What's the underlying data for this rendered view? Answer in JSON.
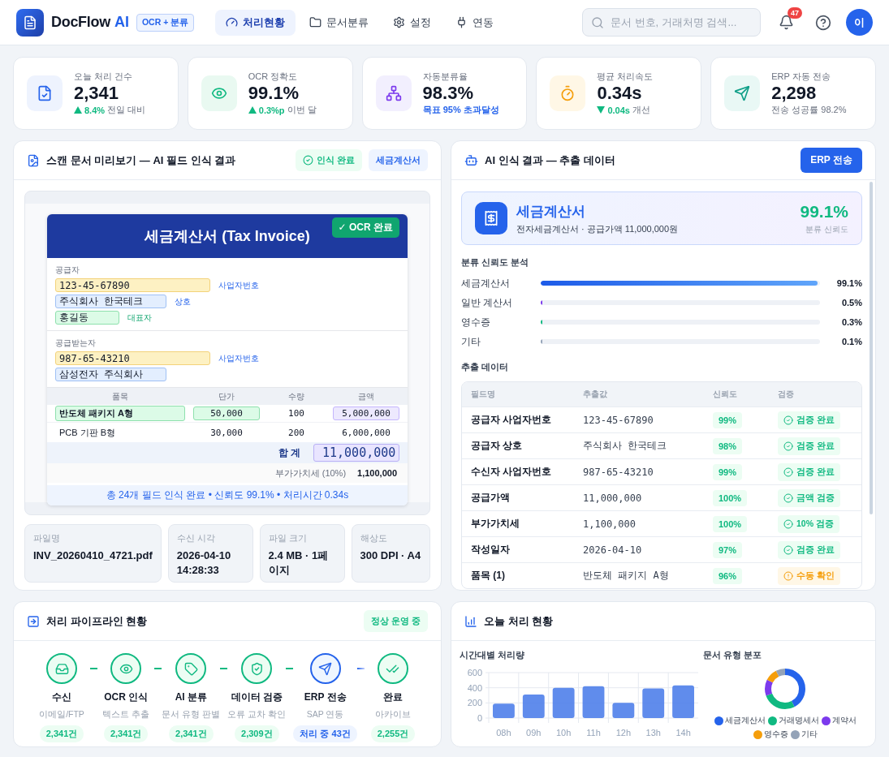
{
  "header": {
    "brand": "DocFlow",
    "brand_accent": "AI",
    "badge": "OCR + 분류",
    "tabs": [
      {
        "label": "처리현황",
        "selected": true
      },
      {
        "label": "문서분류",
        "selected": false
      },
      {
        "label": "설정",
        "selected": false
      },
      {
        "label": "연동",
        "selected": false
      }
    ],
    "search": {
      "placeholder": "문서 번호, 거래처명 검색..."
    },
    "notifications": "47",
    "avatar": "이"
  },
  "stats": [
    {
      "label": "오늘 처리 건수",
      "value": "2,341",
      "kind": "up",
      "delta": "8.4%",
      "note": "전일 대비",
      "note_accent": false
    },
    {
      "label": "OCR 정확도",
      "value": "99.1%",
      "kind": "up",
      "delta": "0.3%p",
      "note": "이번 달",
      "note_accent": false
    },
    {
      "label": "자동분류율",
      "value": "98.3%",
      "kind": "plain",
      "note": "목표 95% 초과달성",
      "note_accent": true
    },
    {
      "label": "평균 처리속도",
      "value": "0.34s",
      "kind": "down",
      "delta": "0.04s",
      "note": "개선",
      "note_accent": false
    },
    {
      "label": "ERP 자동 전송",
      "value": "2,298",
      "kind": "plain",
      "note": "전송 성공률 98.2%",
      "note_accent": false
    }
  ],
  "preview": {
    "title": "스캔 문서 미리보기 — AI 필드 인식 결과",
    "badges": [
      {
        "label": "인식 완료",
        "kind": "success"
      },
      {
        "label": "세금계산서",
        "kind": "info"
      }
    ],
    "document": {
      "title": "세금계산서 (Tax Invoice)",
      "stamp": "✓ OCR 완료",
      "parties": [
        {
          "label": "공급자",
          "fields": [
            {
              "value": "123-45-67890",
              "tag": "사업자번호",
              "kind": "id"
            },
            {
              "value": "주식회사 한국테크",
              "tag": "상호",
              "kind": "name"
            },
            {
              "value": "홍길동",
              "tag": "대표자",
              "kind": "person"
            }
          ]
        },
        {
          "label": "공급받는자",
          "fields": [
            {
              "value": "987-65-43210",
              "tag": "사업자번호",
              "kind": "id"
            },
            {
              "value": "삼성전자 주식회사",
              "kind": "name"
            }
          ]
        }
      ],
      "columns": [
        "품목",
        "단가",
        "수량",
        "금액"
      ],
      "items": [
        {
          "cells": [
            {
              "text": "반도체 패키지 A형",
              "highlight": true
            },
            {
              "text": "50,000",
              "highlight": true
            },
            {
              "text": "100",
              "highlight": false
            },
            {
              "text": "5,000,000",
              "highlight": true
            }
          ]
        },
        {
          "cells": [
            {
              "text": "PCB 기판 B형",
              "highlight": false
            },
            {
              "text": "30,000",
              "highlight": false
            },
            {
              "text": "200",
              "highlight": false
            },
            {
              "text": "6,000,000",
              "highlight": false
            }
          ]
        }
      ],
      "total": {
        "label": "합 계",
        "value": "11,000,000"
      },
      "vat": {
        "label": "부가가치세 (10%)",
        "value": "1,100,000"
      },
      "summary": "총 24개 필드 인식 완료 • 신뢰도 99.1% • 처리시간 0.34s"
    },
    "file_info": [
      {
        "label": "파일명",
        "value": "INV_20260410_4721.pdf"
      },
      {
        "label": "수신 시각",
        "value": "2026-04-10 14:28:33"
      },
      {
        "label": "파일 크기",
        "value": "2.4 MB · 1페이지"
      },
      {
        "label": "해상도",
        "value": "300 DPI · A4"
      }
    ]
  },
  "extraction": {
    "title": "AI 인식 결과 — 추출 데이터",
    "action": "ERP 전송",
    "result": {
      "type": "세금계산서",
      "detail": "전자세금계산서 · 공급가액 11,000,000원",
      "score": "99.1%",
      "score_label": "분류 신뢰도"
    },
    "confidence_title": "분류 신뢰도 분석",
    "confidence": [
      {
        "label": "세금계산서",
        "level": 0.991,
        "reading": "99.1%"
      },
      {
        "label": "일반 계산서",
        "level": 0.005,
        "reading": "0.5%"
      },
      {
        "label": "영수증",
        "level": 0.003,
        "reading": "0.3%"
      },
      {
        "label": "기타",
        "level": 0.001,
        "reading": "0.1%"
      }
    ],
    "table_title": "추출 데이터",
    "columns": [
      "필드명",
      "추출값",
      "신뢰도",
      "검증"
    ],
    "rows": [
      {
        "field": "공급자 사업자번호",
        "value": "123-45-67890",
        "confidence": "99%",
        "check": "검증 완료",
        "kind": "ok"
      },
      {
        "field": "공급자 상호",
        "value": "주식회사 한국테크",
        "confidence": "98%",
        "check": "검증 완료",
        "kind": "ok"
      },
      {
        "field": "수신자 사업자번호",
        "value": "987-65-43210",
        "confidence": "99%",
        "check": "검증 완료",
        "kind": "ok"
      },
      {
        "field": "공급가액",
        "value": "11,000,000",
        "confidence": "100%",
        "check": "금액 검증",
        "kind": "ok"
      },
      {
        "field": "부가가치세",
        "value": "1,100,000",
        "confidence": "100%",
        "check": "10% 검증",
        "kind": "ok"
      },
      {
        "field": "작성일자",
        "value": "2026-04-10",
        "confidence": "97%",
        "check": "검증 완료",
        "kind": "ok"
      },
      {
        "field": "품목 (1)",
        "value": "반도체 패키지 A형",
        "confidence": "96%",
        "check": "수동 확인",
        "kind": "warn"
      }
    ]
  },
  "pipeline": {
    "title": "처리 파이프라인 현황",
    "status": "정상 운영 중",
    "steps": [
      {
        "name": "수신",
        "detail": "이메일/FTP",
        "count": "2,341건",
        "kind": "done"
      },
      {
        "name": "OCR 인식",
        "detail": "텍스트 추출",
        "count": "2,341건",
        "kind": "done"
      },
      {
        "name": "AI 분류",
        "detail": "문서 유형 판별",
        "count": "2,341건",
        "kind": "done"
      },
      {
        "name": "데이터 검증",
        "detail": "오류 교차 확인",
        "count": "2,309건",
        "kind": "done"
      },
      {
        "name": "ERP 전송",
        "detail": "SAP 연동",
        "count": "처리 중 43건",
        "kind": "active"
      },
      {
        "name": "완료",
        "detail": "아카이브",
        "count": "2,255건",
        "kind": "done"
      }
    ]
  },
  "today": {
    "title": "오늘 처리 현황",
    "hourly": {
      "title": "시간대별 처리량",
      "chart_data": {
        "type": "bar",
        "categories": [
          "08h",
          "09h",
          "10h",
          "11h",
          "12h",
          "13h",
          "14h"
        ],
        "values": [
          190,
          310,
          400,
          420,
          200,
          390,
          430
        ],
        "ylim": [
          0,
          600
        ],
        "yticks": [
          0,
          200,
          400,
          600
        ]
      }
    },
    "distribution": {
      "title": "문서 유형 분포",
      "legend": [
        {
          "label": "세금계산서",
          "color": "#2563eb"
        },
        {
          "label": "거래명세서",
          "color": "#10b981"
        },
        {
          "label": "계약서",
          "color": "#7c3aed"
        },
        {
          "label": "영수증",
          "color": "#f59e0b"
        },
        {
          "label": "기타",
          "color": "#94a3b8"
        }
      ]
    }
  }
}
